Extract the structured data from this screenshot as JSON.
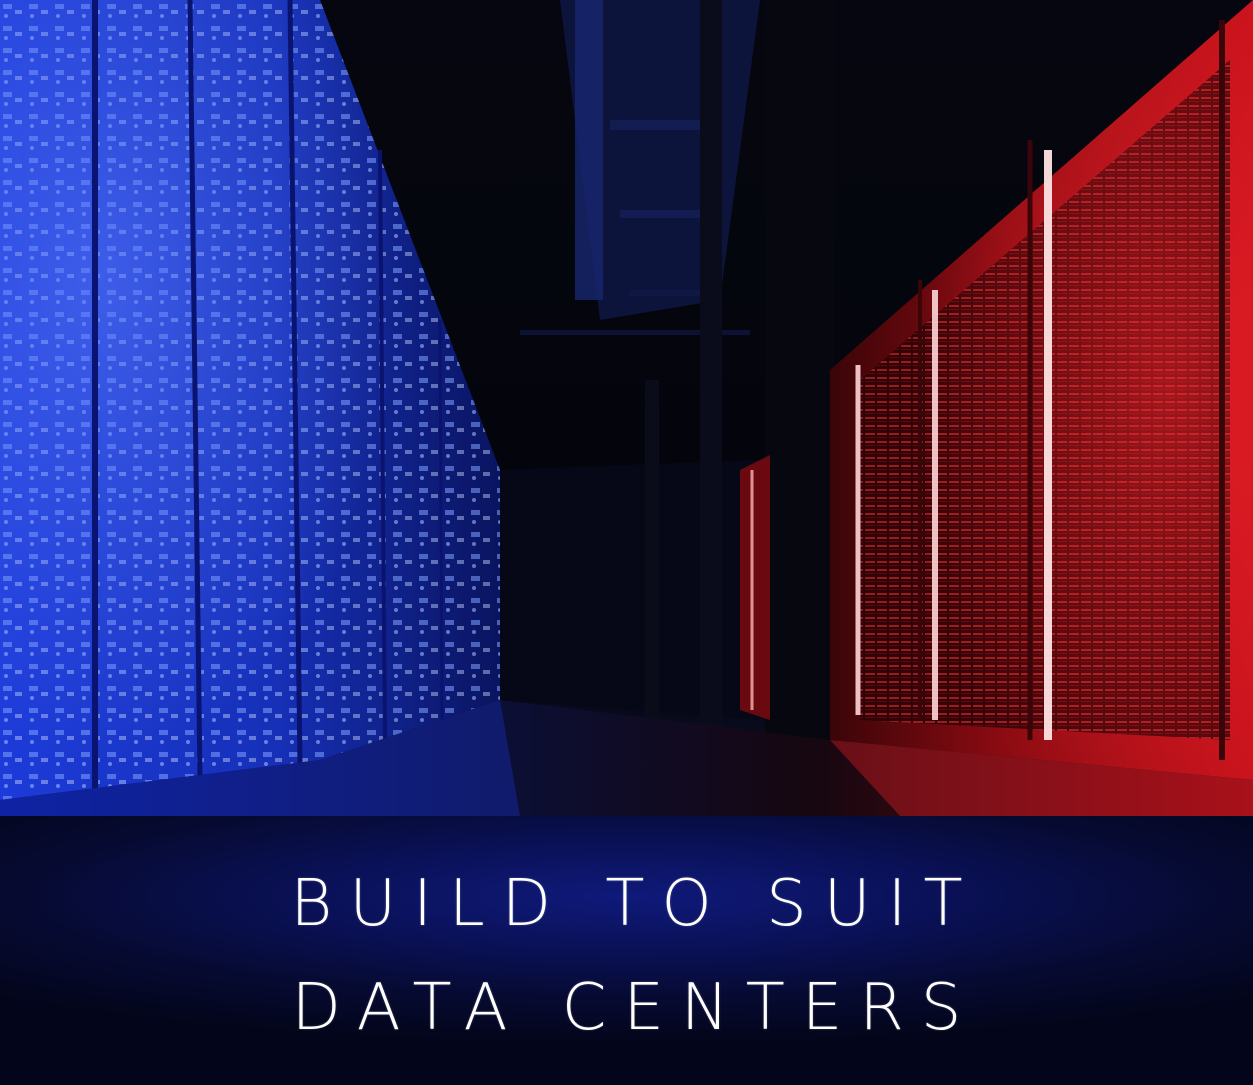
{
  "caption": {
    "line1": "BUILD TO SUIT",
    "line2": "DATA CENTERS"
  },
  "photo": {
    "subject": "data-center-server-aisle",
    "colors": {
      "left_racks": "#1a3cff",
      "right_racks": "#ff1a22",
      "ceiling": "#0a0f33",
      "floor": "#0a0d26"
    }
  },
  "colors": {
    "caption_background": "#0a1158",
    "caption_text": "#ffffff"
  }
}
